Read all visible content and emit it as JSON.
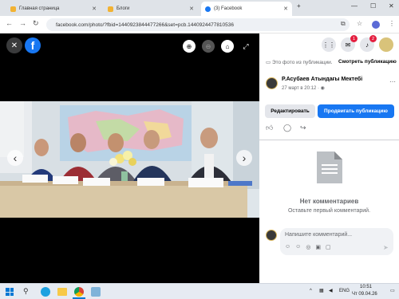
{
  "browser": {
    "tabs": [
      {
        "label": "Главная страница"
      },
      {
        "label": "Блоги"
      },
      {
        "label": "(3) Facebook"
      }
    ],
    "new_tab": "+",
    "window_controls": {
      "minimize": "—",
      "maximize": "☐",
      "close": "✕"
    },
    "url": "facebook.com/photo/?fbid=1440923844477266&set=pcb.1440924477810536"
  },
  "viewer": {
    "close": "✕",
    "logo": "f",
    "prev": "‹",
    "next": "›"
  },
  "panel": {
    "notification_count": "1",
    "messenger_count": "2",
    "photo_notice": "Это фото из публикации.",
    "view_post": "Смотреть публикацию",
    "page_name": "Р.Асубаев Атындағы Мектебі",
    "post_time": "27 март в 20:12 ·",
    "edit_button": "Редактировать",
    "promote_button": "Продвигать публикацию",
    "no_comments_title": "Нет комментариев",
    "no_comments_sub": "Оставьте первый комментарий.",
    "comment_placeholder": "Напишите комментарий..."
  },
  "taskbar": {
    "language": "ENG",
    "time": "10:51",
    "date": "Чт 09.04.26"
  },
  "colors": {
    "facebook_blue": "#1877f2",
    "badge_red": "#e41e3f"
  }
}
